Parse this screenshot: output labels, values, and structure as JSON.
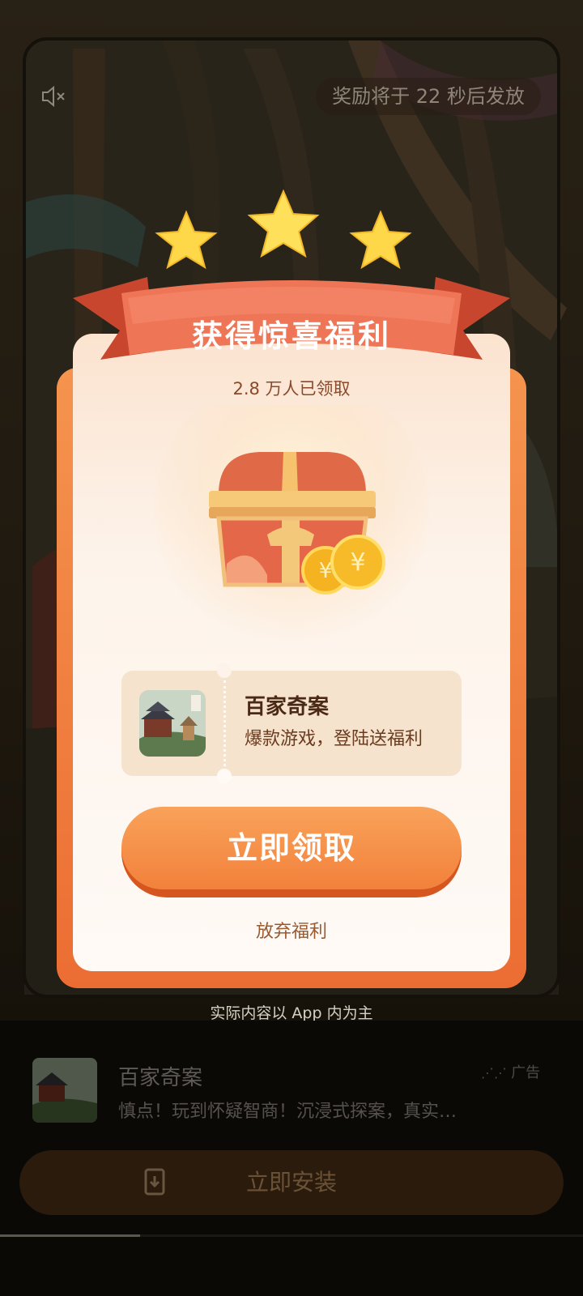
{
  "player": {
    "mute_icon": "speaker-muted-icon",
    "reward_timer_text": "奖励将于 22 秒后发放",
    "caption_behind": "",
    "disclaimer": "实际内容以 App 内为主"
  },
  "popup": {
    "title": "获得惊喜福利",
    "claimed_count": "2.8 万人已领取",
    "app": {
      "name": "百家奇案",
      "description": "爆款游戏，登陆送福利"
    },
    "claim_button_label": "立即领取",
    "give_up_label": "放弃福利",
    "colors": {
      "accent": "#f2813b",
      "ribbon": "#e8654a",
      "star": "#ffd84a"
    }
  },
  "ad": {
    "app_name": "百家奇案",
    "ad_badge": "广告",
    "description": "慎点！玩到怀疑智商！沉浸式探案，真实…",
    "install_label": "立即安装",
    "install_icon": "app-download-icon",
    "progress": 0.24
  }
}
